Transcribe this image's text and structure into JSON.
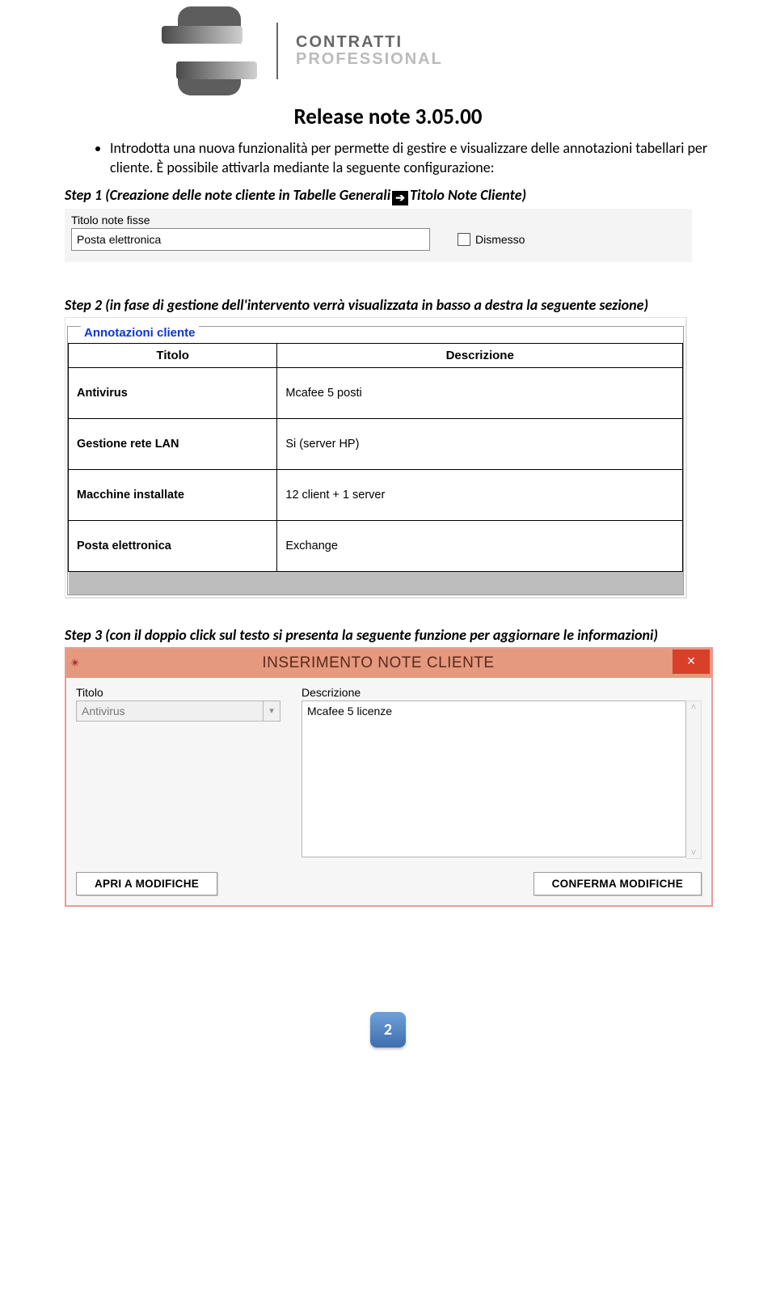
{
  "brand": {
    "line1": "CONTRATTI",
    "line2": "PROFESSIONAL"
  },
  "title": "Release note 3.05.00",
  "bullet_text": "Introdotta una nuova funzionalità per permette di gestire e visualizzare delle annotazioni tabellari per cliente. È possibile attivarla mediante la seguente configurazione:",
  "step1": {
    "prefix": "Step 1 (Creazione delle note cliente in Tabelle Generali",
    "suffix": "Titolo Note Cliente)"
  },
  "shot1": {
    "field_label": "Titolo note fisse",
    "field_value": "Posta elettronica",
    "checkbox_label": "Dismesso"
  },
  "step2": "Step 2 (in fase di gestione dell'intervento verrà visualizzata in basso a destra la seguente sezione)",
  "shot2": {
    "legend": "Annotazioni cliente",
    "headers": {
      "col1": "Titolo",
      "col2": "Descrizione"
    },
    "rows": [
      {
        "title": "Antivirus",
        "desc": "Mcafee 5 posti"
      },
      {
        "title": "Gestione rete LAN",
        "desc": "Si (server HP)"
      },
      {
        "title": "Macchine installate",
        "desc": "12 client + 1 server"
      },
      {
        "title": "Posta elettronica",
        "desc": "Exchange"
      }
    ]
  },
  "step3": "Step 3 (con il doppio click sul testo si presenta la seguente funzione per aggiornare le informazioni)",
  "shot3": {
    "window_title": "INSERIMENTO NOTE CLIENTE",
    "titolo_label": "Titolo",
    "titolo_value": "Antivirus",
    "descr_label": "Descrizione",
    "descr_value": "Mcafee 5 licenze",
    "btn_left": "APRI A MODIFICHE",
    "btn_right": "CONFERMA MODIFICHE"
  },
  "page_number": "2"
}
